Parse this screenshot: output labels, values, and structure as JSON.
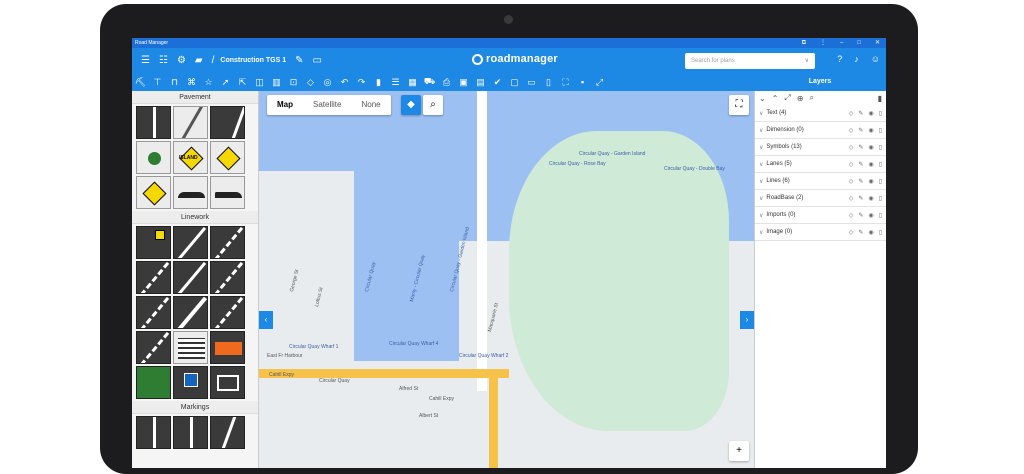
{
  "window": {
    "title": "Road Manager",
    "controls": [
      "⧉",
      "⋮",
      "–",
      "□",
      "✕"
    ]
  },
  "appbar": {
    "project_name": "Construction TGS 1",
    "logo": "roadmanager",
    "search_placeholder": "Search for plans"
  },
  "icons": {
    "menu": "menu-icon",
    "view": "view-icon",
    "settings": "gear-icon",
    "folder": "folder-icon",
    "edit": "pencil-icon",
    "rename": "rename-icon",
    "help": "help-icon",
    "notifications": "bell-icon",
    "account": "account-icon"
  },
  "toolbar": {
    "tools": [
      "road-tool",
      "sign-tool",
      "bench-tool",
      "network-tool",
      "star-tool",
      "select-tool",
      "select-multi-tool",
      "split-tool",
      "columns-tool",
      "crop-tool",
      "lasso-tool",
      "target-tool",
      "undo-tool",
      "redo-tool",
      "delete-tool",
      "list-tool",
      "qr-tool",
      "car-tool",
      "print-tool",
      "image-tool",
      "chat-tool",
      "check-tool",
      "comment-tool",
      "message-tool",
      "doc-tool",
      "focus-tool",
      "save-tool",
      "fullscreen-tool"
    ]
  },
  "palette": {
    "sections": [
      {
        "title": "Pavement"
      },
      {
        "title": "Linework"
      },
      {
        "title": "Markings"
      }
    ],
    "pavement_tiles": [
      "straight-road",
      "curved-road",
      "corner-road",
      "roundabout",
      "island-sign",
      "pedestrian-sign",
      "train-sign",
      "bump-sign",
      "speed-hump"
    ],
    "linework_tiles": [
      "crossing-line",
      "diagonal-line",
      "dashed-line",
      "dashed-line-2",
      "diagonal-line-2",
      "dashed-line-3",
      "double-line",
      "solid-line",
      "dashed-line-4",
      "diagonal-line-3",
      "hatch-zone",
      "orange-zone",
      "bus-lane",
      "parking-zone",
      "disabled-zone"
    ],
    "island_label": "ISLAND"
  },
  "map": {
    "mode_tabs": [
      "Map",
      "Satellite",
      "None"
    ],
    "active_mode": "Map",
    "labels": {
      "circular_quay": "Circular Quay",
      "circular_quay_wharf1": "Circular Quay Wharf 1",
      "circular_quay_wharf4": "Circular Quay Wharf 4",
      "circular_quay_wharf2": "Circular Quay Wharf 2",
      "cahill_expy": "Cahill Expy",
      "circular_quay_garden_island": "Circular Quay - Garden Island",
      "circular_quay_rose_bay": "Circular Quay - Rose Bay",
      "circular_quay_double_bay": "Circular Quay - Double Bay",
      "manly_circular_quay": "Manly - Circular Quay",
      "east_from_harbour": "East Fr Harbour",
      "alfred_st": "Alfred St",
      "albert_st": "Albert St",
      "george_st": "George St",
      "loftus_st": "Loftus St",
      "macquarie_st": "Macquarie St"
    }
  },
  "layers": {
    "title": "Layers",
    "items": [
      {
        "label": "Text (4)"
      },
      {
        "label": "Dimension (0)"
      },
      {
        "label": "Symbols (13)"
      },
      {
        "label": "Lanes (5)"
      },
      {
        "label": "Lines (6)"
      },
      {
        "label": "RoadBase (2)"
      },
      {
        "label": "Imports (0)"
      },
      {
        "label": "Image (0)"
      }
    ]
  },
  "colors": {
    "brand_blue": "#1e88e5",
    "title_blue": "#1d6fd8",
    "water": "#9cc0f2",
    "park": "#cfead6",
    "road_yellow": "#f6c24a"
  }
}
